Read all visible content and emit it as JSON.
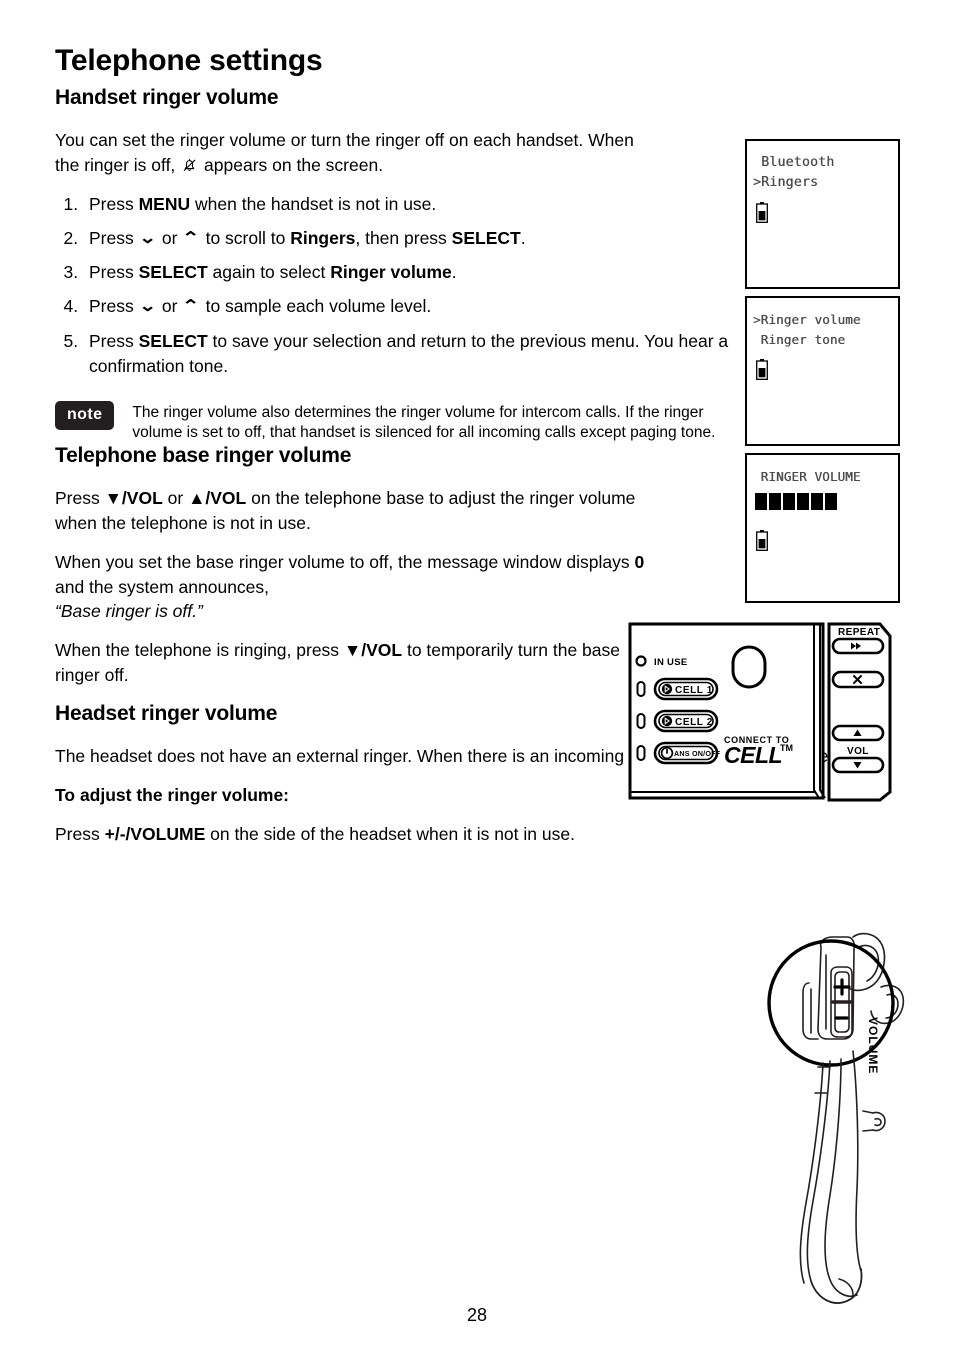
{
  "document": {
    "title": "Telephone settings",
    "page_number": "28"
  },
  "sections": {
    "handset": {
      "heading": "Handset ringer volume",
      "intro_part1": "You can set the ringer volume or turn the ringer off on each handset. When the ringer is off,",
      "intro_icon": "bell-off-icon",
      "intro_part2": "appears on the screen.",
      "steps": [
        {
          "pre": "Press ",
          "bold1": "MENU",
          "post": " when the handset is not in use."
        },
        {
          "pre": "Press ",
          "chev_down": "⌄",
          "mid1": " or ",
          "chev_up": "⌃",
          "mid2": " to scroll to ",
          "bold1": "Ringers",
          "mid3": ", then press ",
          "bold2": "SELECT",
          "post": "."
        },
        {
          "pre": "Press ",
          "bold1": "SELECT",
          "mid1": " again to select ",
          "bold2": "Ringer volume",
          "post": "."
        },
        {
          "pre": "Press ",
          "chev_down": "⌄",
          "mid1": " or ",
          "chev_up": "⌃",
          "mid2": " to sample each volume level."
        },
        {
          "pre": "Press ",
          "bold1": "SELECT",
          "post": " to save your selection and return to the previous menu. You hear a confirmation tone."
        }
      ],
      "note": {
        "badge": "note",
        "text": "The ringer volume also determines the ringer volume for intercom calls. If the ringer volume is set to off, that handset is silenced for all incoming calls except paging tone."
      }
    },
    "base": {
      "heading": "Telephone base ringer volume",
      "p1_pre": "Press ",
      "p1_b1": "▼/VOL",
      "p1_mid": " or ",
      "p1_b2": "▲/VOL",
      "p1_post": " on the telephone base to adjust the ringer volume when the telephone is not in use.",
      "p2_pre": "When you set the base ringer volume to off, the message window displays ",
      "p2_b1": "0",
      "p2_post": " and the system announces,",
      "p2_quote": "“Base ringer is off.”",
      "p3_pre": "When the telephone is ringing, press ",
      "p3_b1": "▼/VOL",
      "p3_post": " to temporarily turn the base ringer off."
    },
    "headset": {
      "heading": "Headset ringer volume",
      "p1": "The headset does not have an external ringer. When there is an incoming call, the headset earpiece rings.",
      "subheading": "To adjust the ringer volume:",
      "p2_pre": "Press ",
      "p2_b1": "+/-/VOLUME",
      "p2_post": " on the side of the headset when it is not in use."
    }
  },
  "lcd_screens": [
    {
      "id": "lcd-1",
      "line1": " Bluetooth",
      "line2": ">Ringers",
      "battery_icon": "battery-icon"
    },
    {
      "id": "lcd-2",
      "line1": ">Ringer volume",
      "line2": " Ringer tone",
      "battery_icon": "battery-icon"
    },
    {
      "id": "lcd-3",
      "line1": " RINGER VOLUME",
      "volume_bars": 6,
      "battery_icon": "battery-icon"
    }
  ],
  "base_illustration": {
    "in_use_label": "IN USE",
    "in_use_led": "led-indicator-icon",
    "buttons": [
      {
        "label": "CELL 1",
        "icon": "bluetooth-icon"
      },
      {
        "label": "CELL 2",
        "icon": "bluetooth-icon"
      },
      {
        "label": "ANS ON/OFF",
        "icon": "power-icon"
      }
    ],
    "logo_top": "CONNECT TO",
    "logo_main": "CELL",
    "logo_tm": "™",
    "side_buttons": [
      {
        "label_above": "REPEAT",
        "glyph": "◀◀",
        "icon": "rewind-icon"
      },
      {
        "label_above": "",
        "glyph": "✕",
        "icon": "delete-icon"
      },
      {
        "label_below": "VOL",
        "glyph": "▲",
        "icon": "volume-up-icon"
      },
      {
        "label_above": "",
        "glyph": "▼",
        "icon": "volume-down-icon"
      }
    ],
    "vol_label": "VOL",
    "repeat_label": "REPEAT"
  },
  "headset_illustration": {
    "volume_label": "VOLUME",
    "plus": "+",
    "minus": "-"
  },
  "colors": {
    "ink": "#000000",
    "note_badge_bg": "#231f20",
    "lcd_text": "#4a4a4a"
  }
}
